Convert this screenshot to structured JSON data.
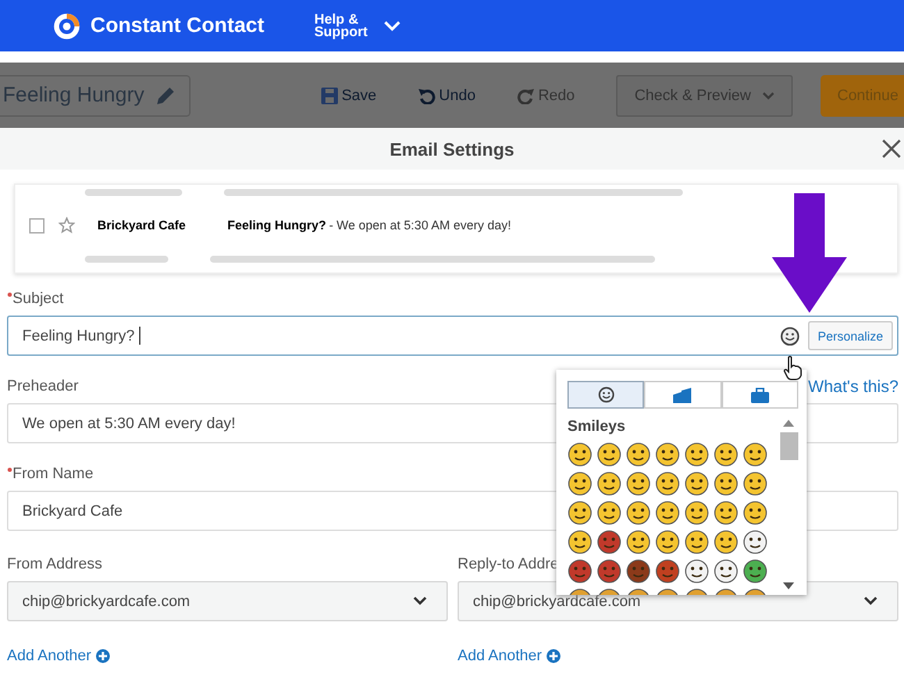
{
  "header": {
    "brand": "Constant Contact",
    "help_menu": "Help & Support"
  },
  "toolbar": {
    "title": "Feeling Hungry",
    "actions": [
      {
        "kind": "save",
        "label": "Save",
        "disabled": false
      },
      {
        "kind": "undo",
        "label": "Undo",
        "disabled": false
      },
      {
        "kind": "redo",
        "label": "Redo",
        "disabled": true
      }
    ],
    "preview": "Check & Preview",
    "continue": "Continue"
  },
  "modal": {
    "title": "Email Settings"
  },
  "inbox_preview": {
    "checked": false,
    "sender": "Brickyard Cafe",
    "subject": "Feeling Hungry?",
    "snippet": "- We open at 5:30 AM every day!"
  },
  "subject": {
    "label": "Subject",
    "required": true,
    "value": "Feeling Hungry?",
    "personalize": "Personalize"
  },
  "emoji_picker": {
    "tabs": [
      {
        "kind": "smiley",
        "selected": true
      },
      {
        "kind": "places",
        "selected": false
      },
      {
        "kind": "objects",
        "selected": false
      }
    ],
    "section": "Smileys",
    "emojis": [
      {
        "color": "#f4c430"
      },
      {
        "color": "#f4c430"
      },
      {
        "color": "#f4c430"
      },
      {
        "color": "#f4c430"
      },
      {
        "color": "#f4c430"
      },
      {
        "color": "#f4c430"
      },
      {
        "color": "#f4c430"
      },
      {
        "color": "#f4c430"
      },
      {
        "color": "#f4c430"
      },
      {
        "color": "#f4c430"
      },
      {
        "color": "#f4c430"
      },
      {
        "color": "#f4c430"
      },
      {
        "color": "#f4c430"
      },
      {
        "color": "#f4c430"
      },
      {
        "color": "#f4c430"
      },
      {
        "color": "#f4c430"
      },
      {
        "color": "#f4c430"
      },
      {
        "color": "#f4c430"
      },
      {
        "color": "#f4c430"
      },
      {
        "color": "#f4c430"
      },
      {
        "color": "#f4c430"
      },
      {
        "color": "#f4c430"
      },
      {
        "color": "#c0392b"
      },
      {
        "color": "#f4c430"
      },
      {
        "color": "#f4c430"
      },
      {
        "color": "#f4c430"
      },
      {
        "color": "#f4c430"
      },
      {
        "color": "#f2f2f2"
      },
      {
        "color": "#c0392b"
      },
      {
        "color": "#c0392b"
      },
      {
        "color": "#8b3a1a"
      },
      {
        "color": "#c04020"
      },
      {
        "color": "#f2f2f2"
      },
      {
        "color": "#f2f2f2"
      },
      {
        "color": "#4caf50"
      },
      {
        "color": "#e0a030"
      },
      {
        "color": "#e0a030"
      },
      {
        "color": "#e0a030"
      },
      {
        "color": "#e0a030"
      },
      {
        "color": "#e0a030"
      },
      {
        "color": "#e0a030"
      },
      {
        "color": "#e0a030"
      }
    ]
  },
  "preheader": {
    "label": "Preheader",
    "help_link": "What's this?",
    "value": "We open at 5:30 AM every day!"
  },
  "from_name": {
    "label": "From Name",
    "required": true,
    "value": "Brickyard Cafe"
  },
  "from_address": {
    "label": "From Address",
    "value": "chip@brickyardcafe.com",
    "add_link": "Add Another"
  },
  "reply_to": {
    "label": "Reply-to Addre",
    "value": "chip@brickyardcafe.com",
    "add_link": "Add Another"
  }
}
